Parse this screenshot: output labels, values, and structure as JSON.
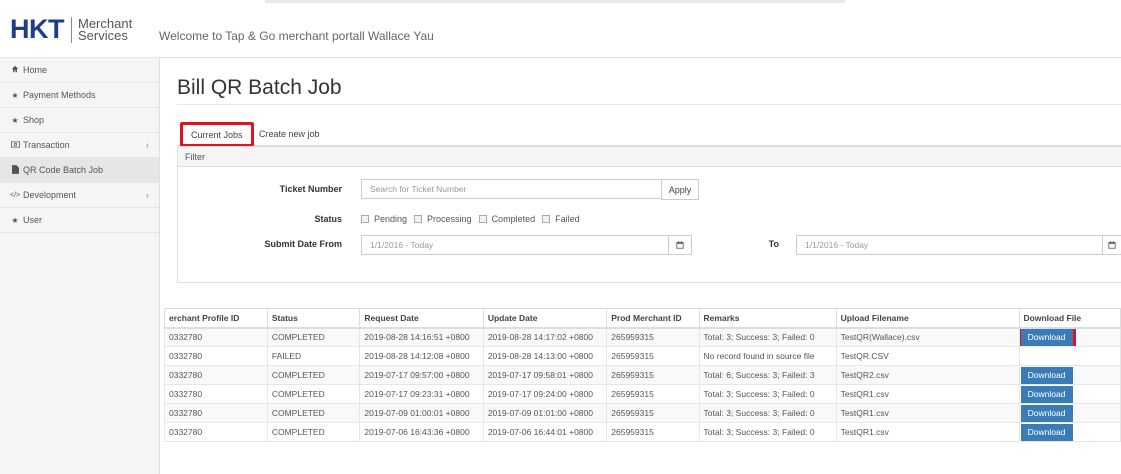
{
  "header": {
    "logo_main": "HKT",
    "logo_sub1": "Merchant",
    "logo_sub2": "Services",
    "welcome": "Welcome to Tap & Go merchant portall Wallace Yau"
  },
  "sidebar": {
    "items": [
      {
        "label": "Home",
        "icon": "home-icon"
      },
      {
        "label": "Payment Methods",
        "icon": "star-icon"
      },
      {
        "label": "Shop",
        "icon": "star-icon"
      },
      {
        "label": "Transaction",
        "icon": "money-icon",
        "caret": "‹"
      },
      {
        "label": "QR Code Batch Job",
        "icon": "file-icon"
      },
      {
        "label": "Development",
        "icon": "code-icon",
        "caret": "‹"
      },
      {
        "label": "User",
        "icon": "star-icon"
      }
    ]
  },
  "page": {
    "title": "Bill QR Batch Job"
  },
  "tabs": {
    "current": "Current Jobs",
    "create": "Create new job"
  },
  "filter": {
    "heading": "Filter",
    "ticket_label": "Ticket Number",
    "ticket_placeholder": "Search for Ticket Number",
    "apply": "Apply",
    "status_label": "Status",
    "statuses": [
      "Pending",
      "Processing",
      "Completed",
      "Failed"
    ],
    "submit_from_label": "Submit Date From",
    "from_value": "1/1/2016 - Today",
    "to_label": "To",
    "to_value": "1/1/2016 - Today"
  },
  "table": {
    "columns": [
      "erchant Profile ID",
      "Status",
      "Request Date",
      "Update Date",
      "Prod Merchant ID",
      "Remarks",
      "Upload Filename",
      "Download File"
    ],
    "download_label": "Download",
    "rows": [
      {
        "profile": "0332780",
        "status": "COMPLETED",
        "request": "2019-08-28 14:16:51 +0800",
        "update": "2019-08-28 14:17:02 +0800",
        "prod": "265959315",
        "remarks": "Total: 3; Success: 3; Failed: 0",
        "file": "TestQR(Wallace).csv",
        "download": true
      },
      {
        "profile": "0332780",
        "status": "FAILED",
        "request": "2019-08-28 14:12:08 +0800",
        "update": "2019-08-28 14:13:00 +0800",
        "prod": "265959315",
        "remarks": "No record found in source file",
        "file": "TestQR.CSV",
        "download": false
      },
      {
        "profile": "0332780",
        "status": "COMPLETED",
        "request": "2019-07-17 09:57:00 +0800",
        "update": "2019-07-17 09:58:01 +0800",
        "prod": "265959315",
        "remarks": "Total: 6; Success: 3; Failed: 3",
        "file": "TestQR2.csv",
        "download": true
      },
      {
        "profile": "0332780",
        "status": "COMPLETED",
        "request": "2019-07-17 09:23:31 +0800",
        "update": "2019-07-17 09:24:00 +0800",
        "prod": "265959315",
        "remarks": "Total: 3; Success: 3; Failed: 0",
        "file": "TestQR1.csv",
        "download": true
      },
      {
        "profile": "0332780",
        "status": "COMPLETED",
        "request": "2019-07-09 01:00:01 +0800",
        "update": "2019-07-09 01:01:00 +0800",
        "prod": "265959315",
        "remarks": "Total: 3; Success: 3; Failed: 0",
        "file": "TestQR1.csv",
        "download": true
      },
      {
        "profile": "0332780",
        "status": "COMPLETED",
        "request": "2019-07-06 16:43:36 +0800",
        "update": "2019-07-06 16:44:01 +0800",
        "prod": "265959315",
        "remarks": "Total: 3; Success: 3; Failed: 0",
        "file": "TestQR1.csv",
        "download": true
      }
    ]
  },
  "colors": {
    "brand": "#1f3e86",
    "highlight": "#e0131e",
    "download_button": "#3a7cb8"
  }
}
